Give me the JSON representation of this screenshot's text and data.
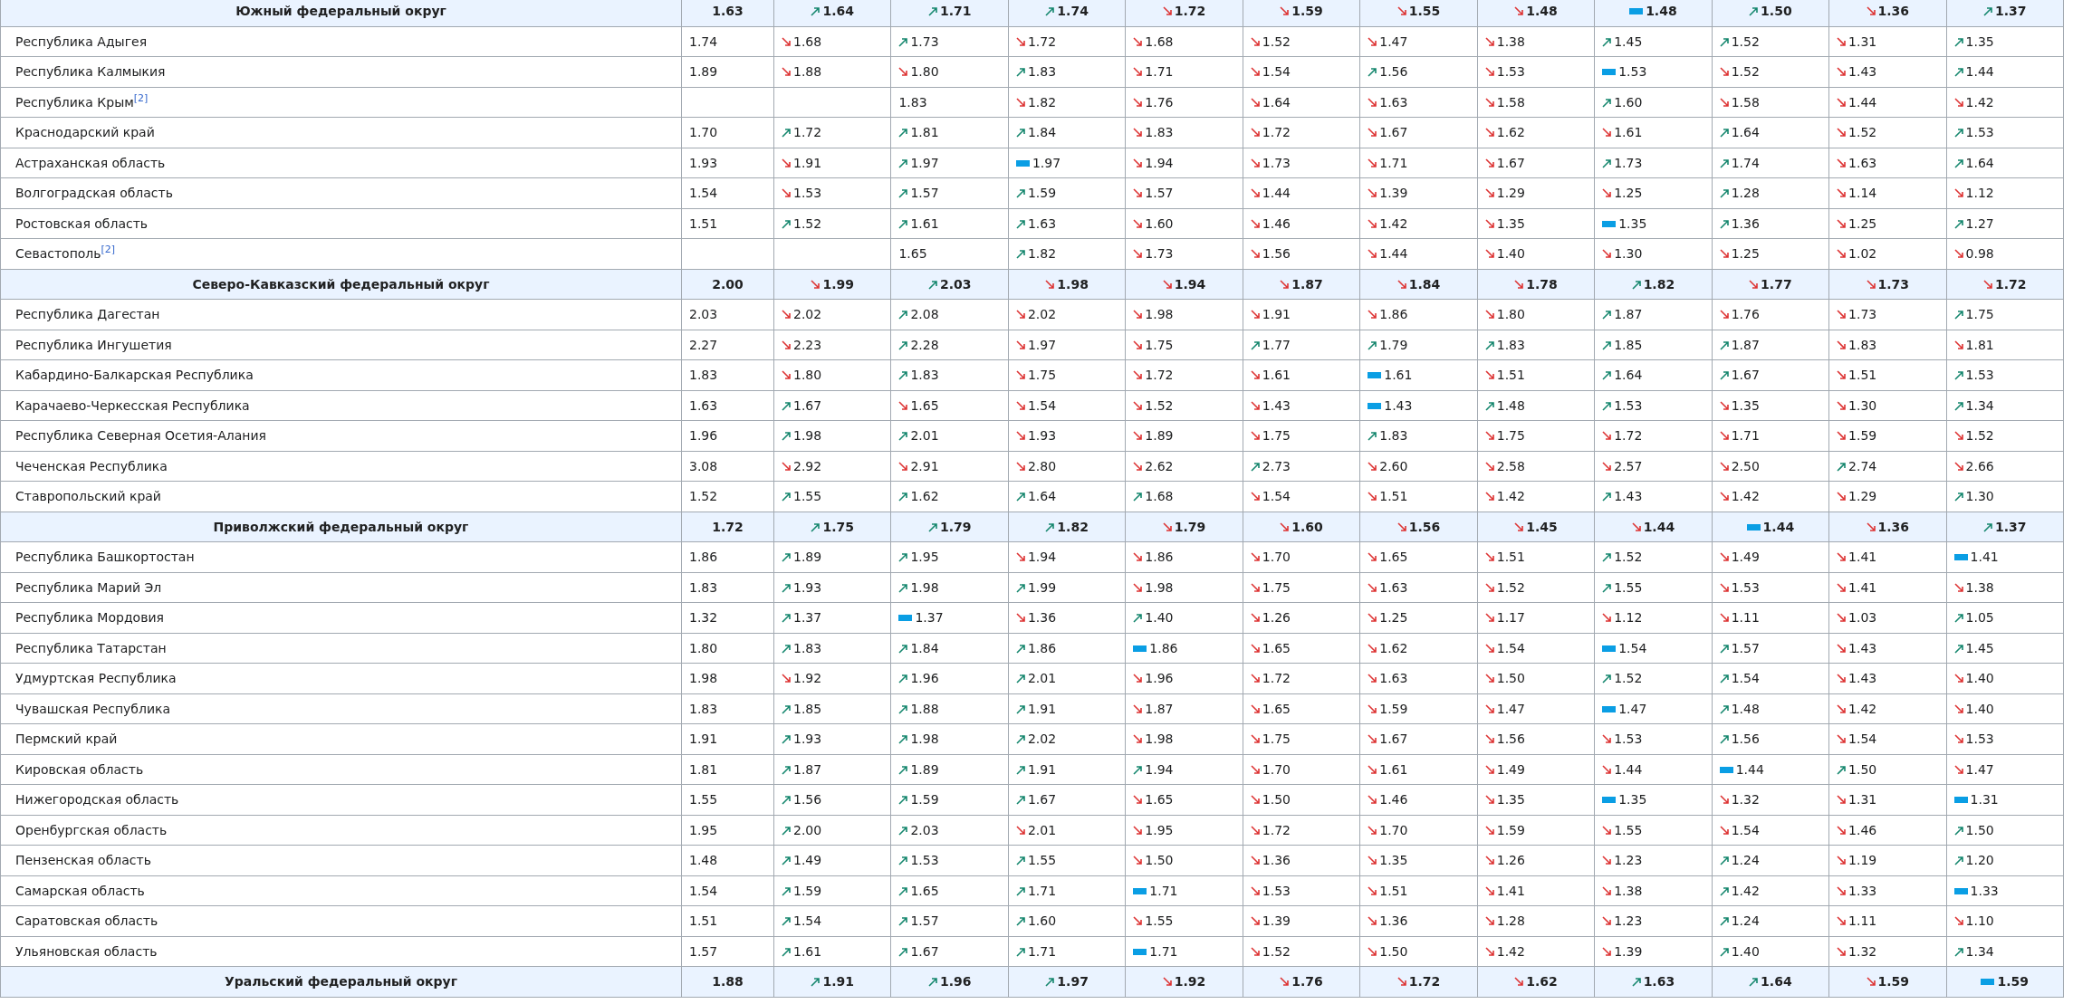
{
  "rows": [
    {
      "kind": "district",
      "name": "Южный федеральный округ",
      "first": "1.63",
      "cells": [
        {
          "value": "1.64",
          "kind": "up"
        },
        {
          "value": "1.71",
          "kind": "up"
        },
        {
          "value": "1.74",
          "kind": "up"
        },
        {
          "value": "1.72",
          "kind": "down"
        },
        {
          "value": "1.59",
          "kind": "down"
        },
        {
          "value": "1.55",
          "kind": "down"
        },
        {
          "value": "1.48",
          "kind": "down"
        },
        {
          "value": "1.48",
          "kind": "same"
        },
        {
          "value": "1.50",
          "kind": "up"
        },
        {
          "value": "1.36",
          "kind": "down"
        },
        {
          "value": "1.37",
          "kind": "up"
        }
      ]
    },
    {
      "kind": "region",
      "name": "Республика Адыгея",
      "first": "1.74",
      "cells": [
        {
          "value": "1.68",
          "kind": "down"
        },
        {
          "value": "1.73",
          "kind": "up"
        },
        {
          "value": "1.72",
          "kind": "down"
        },
        {
          "value": "1.68",
          "kind": "down"
        },
        {
          "value": "1.52",
          "kind": "down"
        },
        {
          "value": "1.47",
          "kind": "down"
        },
        {
          "value": "1.38",
          "kind": "down"
        },
        {
          "value": "1.45",
          "kind": "up"
        },
        {
          "value": "1.52",
          "kind": "up"
        },
        {
          "value": "1.31",
          "kind": "down"
        },
        {
          "value": "1.35",
          "kind": "up"
        }
      ]
    },
    {
      "kind": "region",
      "name": "Республика Калмыкия",
      "first": "1.89",
      "cells": [
        {
          "value": "1.88",
          "kind": "down"
        },
        {
          "value": "1.80",
          "kind": "down"
        },
        {
          "value": "1.83",
          "kind": "up"
        },
        {
          "value": "1.71",
          "kind": "down"
        },
        {
          "value": "1.54",
          "kind": "down"
        },
        {
          "value": "1.56",
          "kind": "up"
        },
        {
          "value": "1.53",
          "kind": "down"
        },
        {
          "value": "1.53",
          "kind": "same"
        },
        {
          "value": "1.52",
          "kind": "down"
        },
        {
          "value": "1.43",
          "kind": "down"
        },
        {
          "value": "1.44",
          "kind": "up"
        }
      ]
    },
    {
      "kind": "region",
      "name": "Республика Крым",
      "note": "[2]",
      "cells": [
        {
          "kind": "empty"
        },
        {
          "value": "1.83",
          "kind": "plain"
        },
        {
          "value": "1.82",
          "kind": "down"
        },
        {
          "value": "1.76",
          "kind": "down"
        },
        {
          "value": "1.64",
          "kind": "down"
        },
        {
          "value": "1.63",
          "kind": "down"
        },
        {
          "value": "1.58",
          "kind": "down"
        },
        {
          "value": "1.60",
          "kind": "up"
        },
        {
          "value": "1.58",
          "kind": "down"
        },
        {
          "value": "1.44",
          "kind": "down"
        },
        {
          "value": "1.42",
          "kind": "down"
        }
      ]
    },
    {
      "kind": "region",
      "name": "Краснодарский край",
      "first": "1.70",
      "cells": [
        {
          "value": "1.72",
          "kind": "up"
        },
        {
          "value": "1.81",
          "kind": "up"
        },
        {
          "value": "1.84",
          "kind": "up"
        },
        {
          "value": "1.83",
          "kind": "down"
        },
        {
          "value": "1.72",
          "kind": "down"
        },
        {
          "value": "1.67",
          "kind": "down"
        },
        {
          "value": "1.62",
          "kind": "down"
        },
        {
          "value": "1.61",
          "kind": "down"
        },
        {
          "value": "1.64",
          "kind": "up"
        },
        {
          "value": "1.52",
          "kind": "down"
        },
        {
          "value": "1.53",
          "kind": "up"
        }
      ]
    },
    {
      "kind": "region",
      "name": "Астраханская область",
      "first": "1.93",
      "cells": [
        {
          "value": "1.91",
          "kind": "down"
        },
        {
          "value": "1.97",
          "kind": "up"
        },
        {
          "value": "1.97",
          "kind": "same"
        },
        {
          "value": "1.94",
          "kind": "down"
        },
        {
          "value": "1.73",
          "kind": "down"
        },
        {
          "value": "1.71",
          "kind": "down"
        },
        {
          "value": "1.67",
          "kind": "down"
        },
        {
          "value": "1.73",
          "kind": "up"
        },
        {
          "value": "1.74",
          "kind": "up"
        },
        {
          "value": "1.63",
          "kind": "down"
        },
        {
          "value": "1.64",
          "kind": "up"
        }
      ]
    },
    {
      "kind": "region",
      "name": "Волгоградская область",
      "first": "1.54",
      "cells": [
        {
          "value": "1.53",
          "kind": "down"
        },
        {
          "value": "1.57",
          "kind": "up"
        },
        {
          "value": "1.59",
          "kind": "up"
        },
        {
          "value": "1.57",
          "kind": "down"
        },
        {
          "value": "1.44",
          "kind": "down"
        },
        {
          "value": "1.39",
          "kind": "down"
        },
        {
          "value": "1.29",
          "kind": "down"
        },
        {
          "value": "1.25",
          "kind": "down"
        },
        {
          "value": "1.28",
          "kind": "up"
        },
        {
          "value": "1.14",
          "kind": "down"
        },
        {
          "value": "1.12",
          "kind": "down"
        }
      ]
    },
    {
      "kind": "region",
      "name": "Ростовская область",
      "first": "1.51",
      "cells": [
        {
          "value": "1.52",
          "kind": "up"
        },
        {
          "value": "1.61",
          "kind": "up"
        },
        {
          "value": "1.63",
          "kind": "up"
        },
        {
          "value": "1.60",
          "kind": "down"
        },
        {
          "value": "1.46",
          "kind": "down"
        },
        {
          "value": "1.42",
          "kind": "down"
        },
        {
          "value": "1.35",
          "kind": "down"
        },
        {
          "value": "1.35",
          "kind": "same"
        },
        {
          "value": "1.36",
          "kind": "up"
        },
        {
          "value": "1.25",
          "kind": "down"
        },
        {
          "value": "1.27",
          "kind": "up"
        }
      ]
    },
    {
      "kind": "region",
      "name": "Севастополь",
      "note": "[2]",
      "cells": [
        {
          "kind": "empty"
        },
        {
          "value": "1.65",
          "kind": "plain"
        },
        {
          "value": "1.82",
          "kind": "up"
        },
        {
          "value": "1.73",
          "kind": "down"
        },
        {
          "value": "1.56",
          "kind": "down"
        },
        {
          "value": "1.44",
          "kind": "down"
        },
        {
          "value": "1.40",
          "kind": "down"
        },
        {
          "value": "1.30",
          "kind": "down"
        },
        {
          "value": "1.25",
          "kind": "down"
        },
        {
          "value": "1.02",
          "kind": "down"
        },
        {
          "value": "0.98",
          "kind": "down"
        }
      ]
    },
    {
      "kind": "district",
      "name": "Северо-Кавказский федеральный округ",
      "first": "2.00",
      "cells": [
        {
          "value": "1.99",
          "kind": "down"
        },
        {
          "value": "2.03",
          "kind": "up"
        },
        {
          "value": "1.98",
          "kind": "down"
        },
        {
          "value": "1.94",
          "kind": "down"
        },
        {
          "value": "1.87",
          "kind": "down"
        },
        {
          "value": "1.84",
          "kind": "down"
        },
        {
          "value": "1.78",
          "kind": "down"
        },
        {
          "value": "1.82",
          "kind": "up"
        },
        {
          "value": "1.77",
          "kind": "down"
        },
        {
          "value": "1.73",
          "kind": "down"
        },
        {
          "value": "1.72",
          "kind": "down"
        }
      ]
    },
    {
      "kind": "region",
      "name": "Республика Дагестан",
      "first": "2.03",
      "cells": [
        {
          "value": "2.02",
          "kind": "down"
        },
        {
          "value": "2.08",
          "kind": "up"
        },
        {
          "value": "2.02",
          "kind": "down"
        },
        {
          "value": "1.98",
          "kind": "down"
        },
        {
          "value": "1.91",
          "kind": "down"
        },
        {
          "value": "1.86",
          "kind": "down"
        },
        {
          "value": "1.80",
          "kind": "down"
        },
        {
          "value": "1.87",
          "kind": "up"
        },
        {
          "value": "1.76",
          "kind": "down"
        },
        {
          "value": "1.73",
          "kind": "down"
        },
        {
          "value": "1.75",
          "kind": "up"
        }
      ]
    },
    {
      "kind": "region",
      "name": "Республика Ингушетия",
      "first": "2.27",
      "cells": [
        {
          "value": "2.23",
          "kind": "down"
        },
        {
          "value": "2.28",
          "kind": "up"
        },
        {
          "value": "1.97",
          "kind": "down"
        },
        {
          "value": "1.75",
          "kind": "down"
        },
        {
          "value": "1.77",
          "kind": "up"
        },
        {
          "value": "1.79",
          "kind": "up"
        },
        {
          "value": "1.83",
          "kind": "up"
        },
        {
          "value": "1.85",
          "kind": "up"
        },
        {
          "value": "1.87",
          "kind": "up"
        },
        {
          "value": "1.83",
          "kind": "down"
        },
        {
          "value": "1.81",
          "kind": "down"
        }
      ]
    },
    {
      "kind": "region",
      "name": "Кабардино-Балкарская Республика",
      "first": "1.83",
      "cells": [
        {
          "value": "1.80",
          "kind": "down"
        },
        {
          "value": "1.83",
          "kind": "up"
        },
        {
          "value": "1.75",
          "kind": "down"
        },
        {
          "value": "1.72",
          "kind": "down"
        },
        {
          "value": "1.61",
          "kind": "down"
        },
        {
          "value": "1.61",
          "kind": "same"
        },
        {
          "value": "1.51",
          "kind": "down"
        },
        {
          "value": "1.64",
          "kind": "up"
        },
        {
          "value": "1.67",
          "kind": "up"
        },
        {
          "value": "1.51",
          "kind": "down"
        },
        {
          "value": "1.53",
          "kind": "up"
        }
      ]
    },
    {
      "kind": "region",
      "name": "Карачаево-Черкесская Республика",
      "first": "1.63",
      "cells": [
        {
          "value": "1.67",
          "kind": "up"
        },
        {
          "value": "1.65",
          "kind": "down"
        },
        {
          "value": "1.54",
          "kind": "down"
        },
        {
          "value": "1.52",
          "kind": "down"
        },
        {
          "value": "1.43",
          "kind": "down"
        },
        {
          "value": "1.43",
          "kind": "same"
        },
        {
          "value": "1.48",
          "kind": "up"
        },
        {
          "value": "1.53",
          "kind": "up"
        },
        {
          "value": "1.35",
          "kind": "down"
        },
        {
          "value": "1.30",
          "kind": "down"
        },
        {
          "value": "1.34",
          "kind": "up"
        }
      ]
    },
    {
      "kind": "region",
      "name": "Республика Северная Осетия-Алания",
      "first": "1.96",
      "cells": [
        {
          "value": "1.98",
          "kind": "up"
        },
        {
          "value": "2.01",
          "kind": "up"
        },
        {
          "value": "1.93",
          "kind": "down"
        },
        {
          "value": "1.89",
          "kind": "down"
        },
        {
          "value": "1.75",
          "kind": "down"
        },
        {
          "value": "1.83",
          "kind": "up"
        },
        {
          "value": "1.75",
          "kind": "down"
        },
        {
          "value": "1.72",
          "kind": "down"
        },
        {
          "value": "1.71",
          "kind": "down"
        },
        {
          "value": "1.59",
          "kind": "down"
        },
        {
          "value": "1.52",
          "kind": "down"
        }
      ]
    },
    {
      "kind": "region",
      "name": "Чеченская Республика",
      "first": "3.08",
      "cells": [
        {
          "value": "2.92",
          "kind": "down"
        },
        {
          "value": "2.91",
          "kind": "down"
        },
        {
          "value": "2.80",
          "kind": "down"
        },
        {
          "value": "2.62",
          "kind": "down"
        },
        {
          "value": "2.73",
          "kind": "up"
        },
        {
          "value": "2.60",
          "kind": "down"
        },
        {
          "value": "2.58",
          "kind": "down"
        },
        {
          "value": "2.57",
          "kind": "down"
        },
        {
          "value": "2.50",
          "kind": "down"
        },
        {
          "value": "2.74",
          "kind": "up"
        },
        {
          "value": "2.66",
          "kind": "down"
        }
      ]
    },
    {
      "kind": "region",
      "name": "Ставропольский край",
      "first": "1.52",
      "cells": [
        {
          "value": "1.55",
          "kind": "up"
        },
        {
          "value": "1.62",
          "kind": "up"
        },
        {
          "value": "1.64",
          "kind": "up"
        },
        {
          "value": "1.68",
          "kind": "up"
        },
        {
          "value": "1.54",
          "kind": "down"
        },
        {
          "value": "1.51",
          "kind": "down"
        },
        {
          "value": "1.42",
          "kind": "down"
        },
        {
          "value": "1.43",
          "kind": "up"
        },
        {
          "value": "1.42",
          "kind": "down"
        },
        {
          "value": "1.29",
          "kind": "down"
        },
        {
          "value": "1.30",
          "kind": "up"
        }
      ]
    },
    {
      "kind": "district",
      "name": "Приволжский федеральный округ",
      "first": "1.72",
      "cells": [
        {
          "value": "1.75",
          "kind": "up"
        },
        {
          "value": "1.79",
          "kind": "up"
        },
        {
          "value": "1.82",
          "kind": "up"
        },
        {
          "value": "1.79",
          "kind": "down"
        },
        {
          "value": "1.60",
          "kind": "down"
        },
        {
          "value": "1.56",
          "kind": "down"
        },
        {
          "value": "1.45",
          "kind": "down"
        },
        {
          "value": "1.44",
          "kind": "down"
        },
        {
          "value": "1.44",
          "kind": "same"
        },
        {
          "value": "1.36",
          "kind": "down"
        },
        {
          "value": "1.37",
          "kind": "up"
        }
      ]
    },
    {
      "kind": "region",
      "name": "Республика Башкортостан",
      "first": "1.86",
      "cells": [
        {
          "value": "1.89",
          "kind": "up"
        },
        {
          "value": "1.95",
          "kind": "up"
        },
        {
          "value": "1.94",
          "kind": "down"
        },
        {
          "value": "1.86",
          "kind": "down"
        },
        {
          "value": "1.70",
          "kind": "down"
        },
        {
          "value": "1.65",
          "kind": "down"
        },
        {
          "value": "1.51",
          "kind": "down"
        },
        {
          "value": "1.52",
          "kind": "up"
        },
        {
          "value": "1.49",
          "kind": "down"
        },
        {
          "value": "1.41",
          "kind": "down"
        },
        {
          "value": "1.41",
          "kind": "same"
        }
      ]
    },
    {
      "kind": "region",
      "name": "Республика Марий Эл",
      "first": "1.83",
      "cells": [
        {
          "value": "1.93",
          "kind": "up"
        },
        {
          "value": "1.98",
          "kind": "up"
        },
        {
          "value": "1.99",
          "kind": "up"
        },
        {
          "value": "1.98",
          "kind": "down"
        },
        {
          "value": "1.75",
          "kind": "down"
        },
        {
          "value": "1.63",
          "kind": "down"
        },
        {
          "value": "1.52",
          "kind": "down"
        },
        {
          "value": "1.55",
          "kind": "up"
        },
        {
          "value": "1.53",
          "kind": "down"
        },
        {
          "value": "1.41",
          "kind": "down"
        },
        {
          "value": "1.38",
          "kind": "down"
        }
      ]
    },
    {
      "kind": "region",
      "name": "Республика Мордовия",
      "first": "1.32",
      "cells": [
        {
          "value": "1.37",
          "kind": "up"
        },
        {
          "value": "1.37",
          "kind": "same"
        },
        {
          "value": "1.36",
          "kind": "down"
        },
        {
          "value": "1.40",
          "kind": "up"
        },
        {
          "value": "1.26",
          "kind": "down"
        },
        {
          "value": "1.25",
          "kind": "down"
        },
        {
          "value": "1.17",
          "kind": "down"
        },
        {
          "value": "1.12",
          "kind": "down"
        },
        {
          "value": "1.11",
          "kind": "down"
        },
        {
          "value": "1.03",
          "kind": "down"
        },
        {
          "value": "1.05",
          "kind": "up"
        }
      ]
    },
    {
      "kind": "region",
      "name": "Республика Татарстан",
      "first": "1.80",
      "cells": [
        {
          "value": "1.83",
          "kind": "up"
        },
        {
          "value": "1.84",
          "kind": "up"
        },
        {
          "value": "1.86",
          "kind": "up"
        },
        {
          "value": "1.86",
          "kind": "same"
        },
        {
          "value": "1.65",
          "kind": "down"
        },
        {
          "value": "1.62",
          "kind": "down"
        },
        {
          "value": "1.54",
          "kind": "down"
        },
        {
          "value": "1.54",
          "kind": "same"
        },
        {
          "value": "1.57",
          "kind": "up"
        },
        {
          "value": "1.43",
          "kind": "down"
        },
        {
          "value": "1.45",
          "kind": "up"
        }
      ]
    },
    {
      "kind": "region",
      "name": "Удмуртская Республика",
      "first": "1.98",
      "cells": [
        {
          "value": "1.92",
          "kind": "down"
        },
        {
          "value": "1.96",
          "kind": "up"
        },
        {
          "value": "2.01",
          "kind": "up"
        },
        {
          "value": "1.96",
          "kind": "down"
        },
        {
          "value": "1.72",
          "kind": "down"
        },
        {
          "value": "1.63",
          "kind": "down"
        },
        {
          "value": "1.50",
          "kind": "down"
        },
        {
          "value": "1.52",
          "kind": "up"
        },
        {
          "value": "1.54",
          "kind": "up"
        },
        {
          "value": "1.43",
          "kind": "down"
        },
        {
          "value": "1.40",
          "kind": "down"
        }
      ]
    },
    {
      "kind": "region",
      "name": "Чувашская Республика",
      "first": "1.83",
      "cells": [
        {
          "value": "1.85",
          "kind": "up"
        },
        {
          "value": "1.88",
          "kind": "up"
        },
        {
          "value": "1.91",
          "kind": "up"
        },
        {
          "value": "1.87",
          "kind": "down"
        },
        {
          "value": "1.65",
          "kind": "down"
        },
        {
          "value": "1.59",
          "kind": "down"
        },
        {
          "value": "1.47",
          "kind": "down"
        },
        {
          "value": "1.47",
          "kind": "same"
        },
        {
          "value": "1.48",
          "kind": "up"
        },
        {
          "value": "1.42",
          "kind": "down"
        },
        {
          "value": "1.40",
          "kind": "down"
        }
      ]
    },
    {
      "kind": "region",
      "name": "Пермский край",
      "first": "1.91",
      "cells": [
        {
          "value": "1.93",
          "kind": "up"
        },
        {
          "value": "1.98",
          "kind": "up"
        },
        {
          "value": "2.02",
          "kind": "up"
        },
        {
          "value": "1.98",
          "kind": "down"
        },
        {
          "value": "1.75",
          "kind": "down"
        },
        {
          "value": "1.67",
          "kind": "down"
        },
        {
          "value": "1.56",
          "kind": "down"
        },
        {
          "value": "1.53",
          "kind": "down"
        },
        {
          "value": "1.56",
          "kind": "up"
        },
        {
          "value": "1.54",
          "kind": "down"
        },
        {
          "value": "1.53",
          "kind": "down"
        }
      ]
    },
    {
      "kind": "region",
      "name": "Кировская область",
      "first": "1.81",
      "cells": [
        {
          "value": "1.87",
          "kind": "up"
        },
        {
          "value": "1.89",
          "kind": "up"
        },
        {
          "value": "1.91",
          "kind": "up"
        },
        {
          "value": "1.94",
          "kind": "up"
        },
        {
          "value": "1.70",
          "kind": "down"
        },
        {
          "value": "1.61",
          "kind": "down"
        },
        {
          "value": "1.49",
          "kind": "down"
        },
        {
          "value": "1.44",
          "kind": "down"
        },
        {
          "value": "1.44",
          "kind": "same"
        },
        {
          "value": "1.50",
          "kind": "up"
        },
        {
          "value": "1.47",
          "kind": "down"
        }
      ]
    },
    {
      "kind": "region",
      "name": "Нижегородская область",
      "first": "1.55",
      "cells": [
        {
          "value": "1.56",
          "kind": "up"
        },
        {
          "value": "1.59",
          "kind": "up"
        },
        {
          "value": "1.67",
          "kind": "up"
        },
        {
          "value": "1.65",
          "kind": "down"
        },
        {
          "value": "1.50",
          "kind": "down"
        },
        {
          "value": "1.46",
          "kind": "down"
        },
        {
          "value": "1.35",
          "kind": "down"
        },
        {
          "value": "1.35",
          "kind": "same"
        },
        {
          "value": "1.32",
          "kind": "down"
        },
        {
          "value": "1.31",
          "kind": "down"
        },
        {
          "value": "1.31",
          "kind": "same"
        }
      ]
    },
    {
      "kind": "region",
      "name": "Оренбургская область",
      "first": "1.95",
      "cells": [
        {
          "value": "2.00",
          "kind": "up"
        },
        {
          "value": "2.03",
          "kind": "up"
        },
        {
          "value": "2.01",
          "kind": "down"
        },
        {
          "value": "1.95",
          "kind": "down"
        },
        {
          "value": "1.72",
          "kind": "down"
        },
        {
          "value": "1.70",
          "kind": "down"
        },
        {
          "value": "1.59",
          "kind": "down"
        },
        {
          "value": "1.55",
          "kind": "down"
        },
        {
          "value": "1.54",
          "kind": "down"
        },
        {
          "value": "1.46",
          "kind": "down"
        },
        {
          "value": "1.50",
          "kind": "up"
        }
      ]
    },
    {
      "kind": "region",
      "name": "Пензенская область",
      "first": "1.48",
      "cells": [
        {
          "value": "1.49",
          "kind": "up"
        },
        {
          "value": "1.53",
          "kind": "up"
        },
        {
          "value": "1.55",
          "kind": "up"
        },
        {
          "value": "1.50",
          "kind": "down"
        },
        {
          "value": "1.36",
          "kind": "down"
        },
        {
          "value": "1.35",
          "kind": "down"
        },
        {
          "value": "1.26",
          "kind": "down"
        },
        {
          "value": "1.23",
          "kind": "down"
        },
        {
          "value": "1.24",
          "kind": "up"
        },
        {
          "value": "1.19",
          "kind": "down"
        },
        {
          "value": "1.20",
          "kind": "up"
        }
      ]
    },
    {
      "kind": "region",
      "name": "Самарская область",
      "first": "1.54",
      "cells": [
        {
          "value": "1.59",
          "kind": "up"
        },
        {
          "value": "1.65",
          "kind": "up"
        },
        {
          "value": "1.71",
          "kind": "up"
        },
        {
          "value": "1.71",
          "kind": "same"
        },
        {
          "value": "1.53",
          "kind": "down"
        },
        {
          "value": "1.51",
          "kind": "down"
        },
        {
          "value": "1.41",
          "kind": "down"
        },
        {
          "value": "1.38",
          "kind": "down"
        },
        {
          "value": "1.42",
          "kind": "up"
        },
        {
          "value": "1.33",
          "kind": "down"
        },
        {
          "value": "1.33",
          "kind": "same"
        }
      ]
    },
    {
      "kind": "region",
      "name": "Саратовская область",
      "first": "1.51",
      "cells": [
        {
          "value": "1.54",
          "kind": "up"
        },
        {
          "value": "1.57",
          "kind": "up"
        },
        {
          "value": "1.60",
          "kind": "up"
        },
        {
          "value": "1.55",
          "kind": "down"
        },
        {
          "value": "1.39",
          "kind": "down"
        },
        {
          "value": "1.36",
          "kind": "down"
        },
        {
          "value": "1.28",
          "kind": "down"
        },
        {
          "value": "1.23",
          "kind": "down"
        },
        {
          "value": "1.24",
          "kind": "up"
        },
        {
          "value": "1.11",
          "kind": "down"
        },
        {
          "value": "1.10",
          "kind": "down"
        }
      ]
    },
    {
      "kind": "region",
      "name": "Ульяновская область",
      "first": "1.57",
      "cells": [
        {
          "value": "1.61",
          "kind": "up"
        },
        {
          "value": "1.67",
          "kind": "up"
        },
        {
          "value": "1.71",
          "kind": "up"
        },
        {
          "value": "1.71",
          "kind": "same"
        },
        {
          "value": "1.52",
          "kind": "down"
        },
        {
          "value": "1.50",
          "kind": "down"
        },
        {
          "value": "1.42",
          "kind": "down"
        },
        {
          "value": "1.39",
          "kind": "down"
        },
        {
          "value": "1.40",
          "kind": "up"
        },
        {
          "value": "1.32",
          "kind": "down"
        },
        {
          "value": "1.34",
          "kind": "up"
        }
      ]
    },
    {
      "kind": "district",
      "name": "Уральский федеральный округ",
      "first": "1.88",
      "cells": [
        {
          "value": "1.91",
          "kind": "up"
        },
        {
          "value": "1.96",
          "kind": "up"
        },
        {
          "value": "1.97",
          "kind": "up"
        },
        {
          "value": "1.92",
          "kind": "down"
        },
        {
          "value": "1.76",
          "kind": "down"
        },
        {
          "value": "1.72",
          "kind": "down"
        },
        {
          "value": "1.62",
          "kind": "down"
        },
        {
          "value": "1.63",
          "kind": "up"
        },
        {
          "value": "1.64",
          "kind": "up"
        },
        {
          "value": "1.59",
          "kind": "down"
        },
        {
          "value": "1.59",
          "kind": "same"
        }
      ]
    }
  ]
}
